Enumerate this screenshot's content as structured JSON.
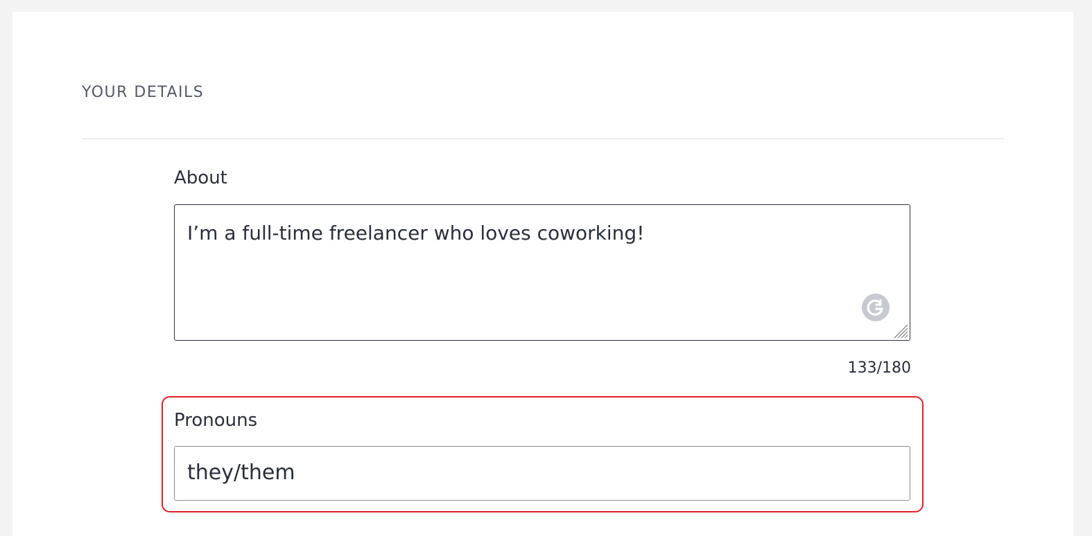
{
  "section": {
    "title": "YOUR DETAILS"
  },
  "about": {
    "label": "About",
    "value": "I’m a full-time freelancer who loves coworking!",
    "counter": "133/180"
  },
  "pronouns": {
    "label": "Pronouns",
    "value": "they/them"
  },
  "colors": {
    "highlight": "#e11d25",
    "text": "#2a2e3b",
    "grammar_icon": "#c7c9d1"
  },
  "icons": {
    "grammar": "grammarly-icon",
    "resize": "resize-handle-icon"
  }
}
